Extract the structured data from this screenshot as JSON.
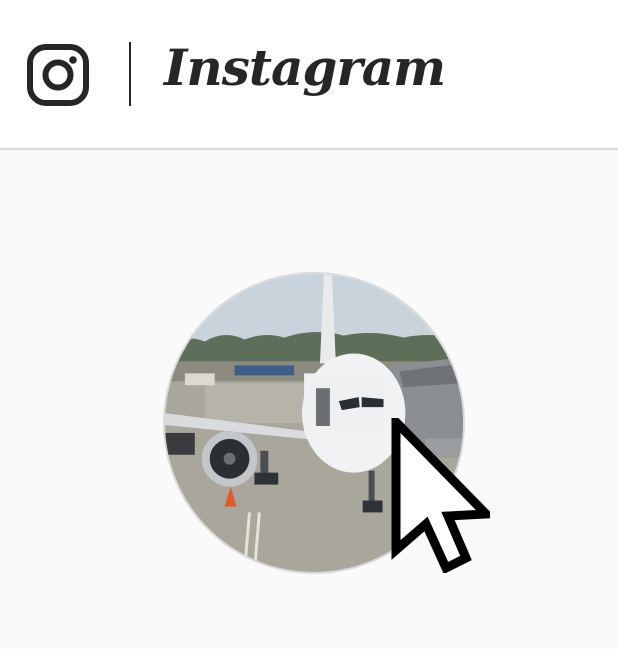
{
  "header": {
    "brand_icon": "camera-glyph-icon",
    "wordmark": "Instagram"
  },
  "profile": {
    "avatar_icon": "airplane-profile-photo"
  },
  "pointer": {
    "icon": "arrow-cursor-icon"
  },
  "colors": {
    "header_bg": "#ffffff",
    "page_bg": "#fafafa",
    "border": "#dbdbdb",
    "ink": "#262626"
  }
}
